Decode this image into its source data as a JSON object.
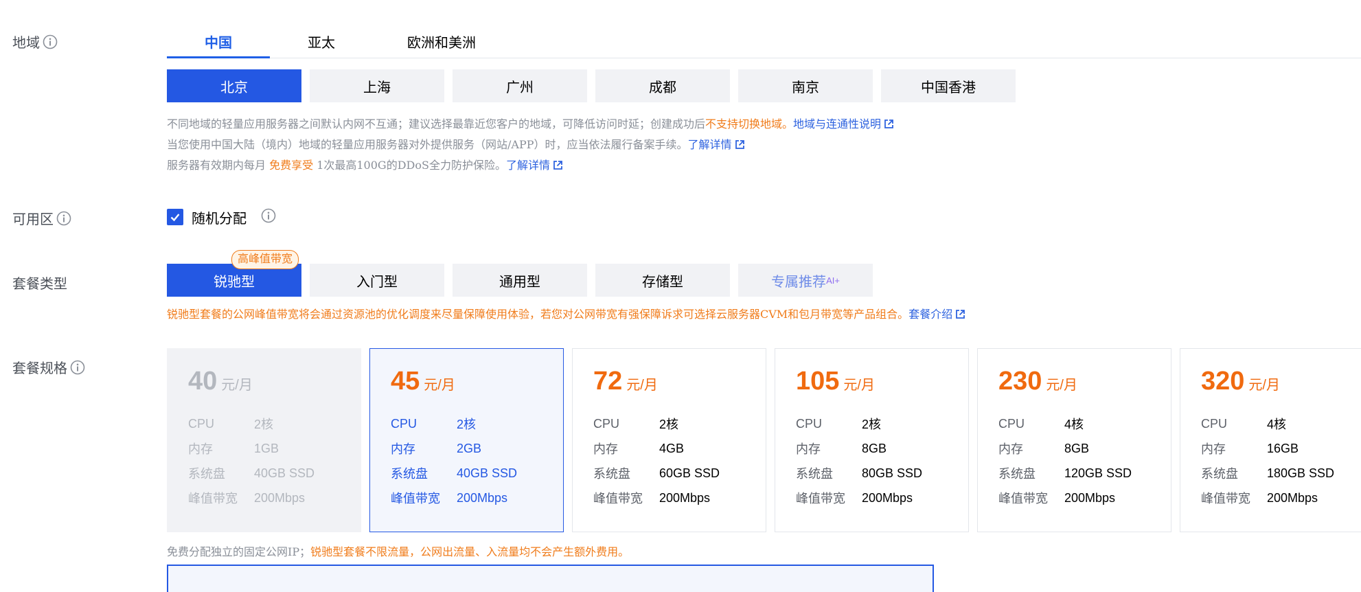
{
  "region": {
    "label": "地域",
    "tabs": [
      "中国",
      "亚太",
      "欧洲和美洲"
    ],
    "cities": [
      "北京",
      "上海",
      "广州",
      "成都",
      "南京",
      "中国香港"
    ],
    "notes": {
      "line1_text": "不同地域的轻量应用服务器之间默认内网不互通；建议选择最靠近您客户的地域，可降低访问时延；创建成功后",
      "line1_warn": "不支持切换地域。",
      "line1_link": "地域与连通性说明",
      "line2_text": "当您使用中国大陆（境内）地域的轻量应用服务器对外提供服务（网站/APP）时，应当依法履行备案手续。",
      "line2_link": "了解详情",
      "line3_text_a": "服务器有效期内每月 ",
      "line3_warn": "免费享受",
      "line3_text_b": " 1次最高100G的DDoS全力防护保险。",
      "line3_link": "了解详情"
    }
  },
  "availability": {
    "label": "可用区",
    "checkbox_label": "随机分配",
    "checked": true
  },
  "plan_type": {
    "label": "套餐类型",
    "badge": "高峰值带宽",
    "options": [
      "锐驰型",
      "入门型",
      "通用型",
      "存储型"
    ],
    "ai_option": "专属推荐",
    "ai_tag": "AI+",
    "note": "锐驰型套餐的公网峰值带宽将会通过资源池的优化调度来尽量保障使用体验，若您对公网带宽有强保障诉求可选择云服务器CVM和包月带宽等产品组合。",
    "note_link": "套餐介绍"
  },
  "plan_spec": {
    "label": "套餐规格",
    "unit": "元/月",
    "spec_keys": [
      "CPU",
      "内存",
      "系统盘",
      "峰值带宽"
    ],
    "cards": [
      {
        "price": "40",
        "specs": [
          "2核",
          "1GB",
          "40GB SSD",
          "200Mbps"
        ],
        "state": "disabled"
      },
      {
        "price": "45",
        "specs": [
          "2核",
          "2GB",
          "40GB SSD",
          "200Mbps"
        ],
        "state": "selected"
      },
      {
        "price": "72",
        "specs": [
          "2核",
          "4GB",
          "60GB SSD",
          "200Mbps"
        ],
        "state": "normal"
      },
      {
        "price": "105",
        "specs": [
          "2核",
          "8GB",
          "80GB SSD",
          "200Mbps"
        ],
        "state": "normal"
      },
      {
        "price": "230",
        "specs": [
          "4核",
          "8GB",
          "120GB SSD",
          "200Mbps"
        ],
        "state": "normal"
      },
      {
        "price": "320",
        "specs": [
          "4核",
          "16GB",
          "180GB SSD",
          "200Mbps"
        ],
        "state": "normal"
      }
    ],
    "footer_text": "免费分配独立的固定公网IP；",
    "footer_warn": "锐驰型套餐不限流量，公网出流量、入流量均不会产生额外费用。"
  },
  "colors": {
    "primary": "#2458e3",
    "warning": "#f07c1b",
    "price": "#f06a0f",
    "muted": "#8a8f98"
  }
}
